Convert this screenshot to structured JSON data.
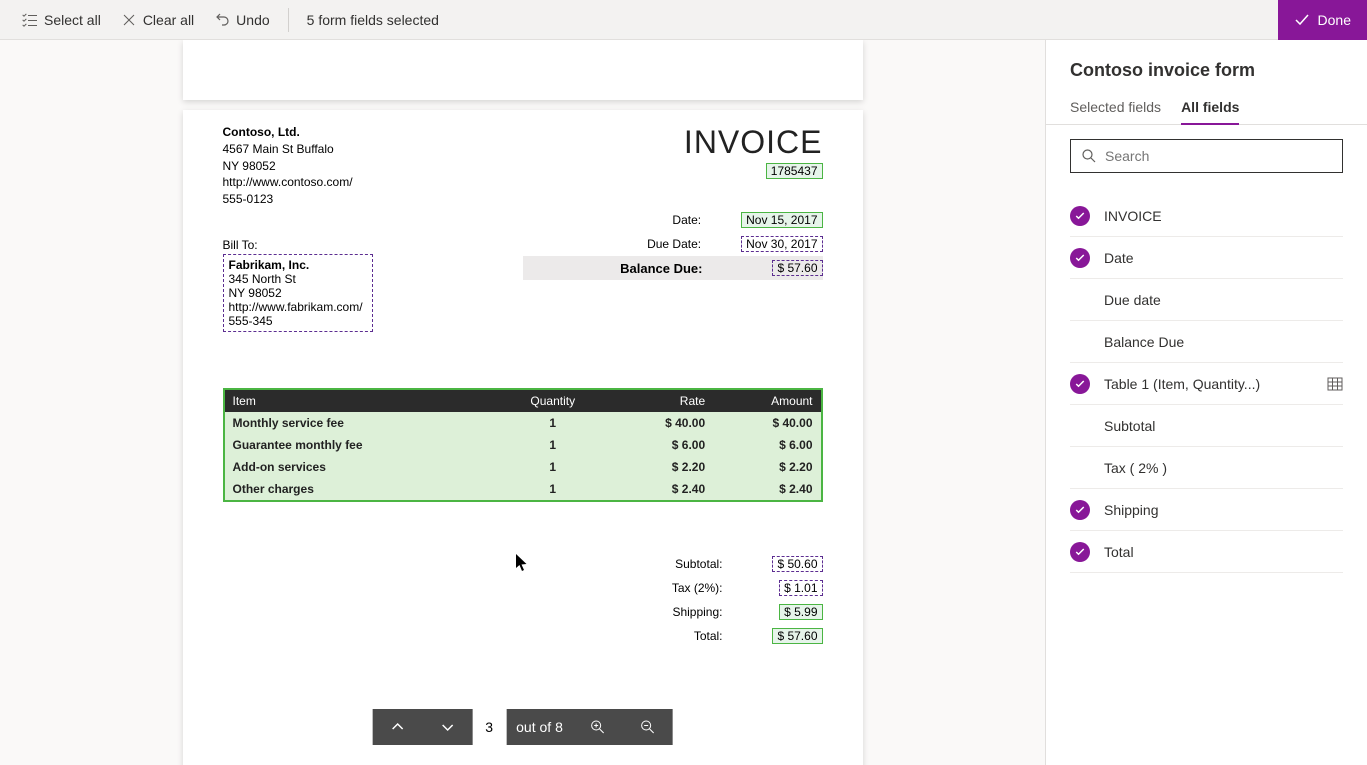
{
  "toolbar": {
    "select_all": "Select all",
    "clear_all": "Clear all",
    "undo": "Undo",
    "status": "5 form fields selected",
    "done": "Done"
  },
  "panel": {
    "title": "Contoso invoice form",
    "tabs": {
      "selected": "Selected fields",
      "all": "All fields"
    },
    "search_placeholder": "Search",
    "fields": [
      {
        "label": "INVOICE",
        "checked": true
      },
      {
        "label": "Date",
        "checked": true
      },
      {
        "label": "Due date",
        "checked": false
      },
      {
        "label": "Balance Due",
        "checked": false
      },
      {
        "label": "Table 1 (Item, Quantity...)",
        "checked": true,
        "tableIcon": true
      },
      {
        "label": "Subtotal",
        "checked": false
      },
      {
        "label": "Tax ( 2% )",
        "checked": false
      },
      {
        "label": "Shipping",
        "checked": true
      },
      {
        "label": "Total",
        "checked": true
      }
    ]
  },
  "invoice": {
    "company": {
      "name": "Contoso, Ltd.",
      "street": "4567 Main St Buffalo",
      "citystate": "NY 98052",
      "url": "http://www.contoso.com/",
      "phone": "555-0123"
    },
    "title": "INVOICE",
    "number": "1785437",
    "billto_label": "Bill To:",
    "billto": {
      "name": "Fabrikam, Inc.",
      "street": "345 North St",
      "citystate": "NY 98052",
      "url": "http://www.fabrikam.com/",
      "phone": "555-345"
    },
    "summary": {
      "date_label": "Date:",
      "date": "Nov 15, 2017",
      "due_label": "Due Date:",
      "due": "Nov 30, 2017",
      "balance_label": "Balance Due:",
      "balance": "$ 57.60"
    },
    "columns": {
      "item": "Item",
      "qty": "Quantity",
      "rate": "Rate",
      "amount": "Amount"
    },
    "rows": [
      {
        "item": "Monthly service fee",
        "qty": "1",
        "rate": "$ 40.00",
        "amount": "$ 40.00"
      },
      {
        "item": "Guarantee monthly fee",
        "qty": "1",
        "rate": "$ 6.00",
        "amount": "$ 6.00"
      },
      {
        "item": "Add-on services",
        "qty": "1",
        "rate": "$ 2.20",
        "amount": "$ 2.20"
      },
      {
        "item": "Other charges",
        "qty": "1",
        "rate": "$ 2.40",
        "amount": "$ 2.40"
      }
    ],
    "totals": {
      "subtotal_label": "Subtotal:",
      "subtotal": "$ 50.60",
      "tax_label": "Tax (2%):",
      "tax": "$ 1.01",
      "shipping_label": "Shipping:",
      "shipping": "$ 5.99",
      "total_label": "Total:",
      "total": "$ 57.60"
    }
  },
  "pager": {
    "current": "3",
    "of": "out of 8"
  }
}
